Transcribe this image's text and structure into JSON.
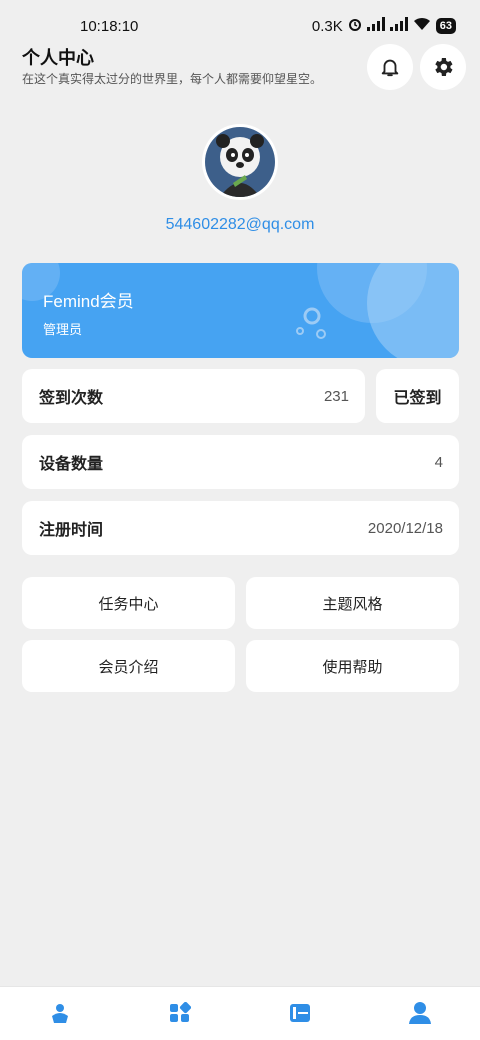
{
  "status_bar": {
    "time": "10:18:10",
    "network_speed": "0.3K",
    "battery": "63"
  },
  "header": {
    "title": "个人中心",
    "subtitle": "在这个真实得太过分的世界里，每个人都需要仰望星空。"
  },
  "profile": {
    "email": "544602282@qq.com",
    "avatar_icon": "panda-avatar"
  },
  "membership": {
    "title": "Femind会员",
    "role": "管理员"
  },
  "checkin": {
    "label": "签到次数",
    "value": "231",
    "button_label": "已签到"
  },
  "devices": {
    "label": "设备数量",
    "value": "4"
  },
  "registration": {
    "label": "注册时间",
    "value": "2020/12/18"
  },
  "actions": {
    "task_center": "任务中心",
    "theme_style": "主题风格",
    "member_intro": "会员介绍",
    "help": "使用帮助"
  },
  "nav": {
    "items": [
      "home-icon",
      "apps-icon",
      "list-icon",
      "profile-icon"
    ],
    "active_color": "#2f8ee6"
  },
  "colors": {
    "accent": "#2f8ee6",
    "card_blue": "#46a3f2",
    "background": "#efefef"
  }
}
